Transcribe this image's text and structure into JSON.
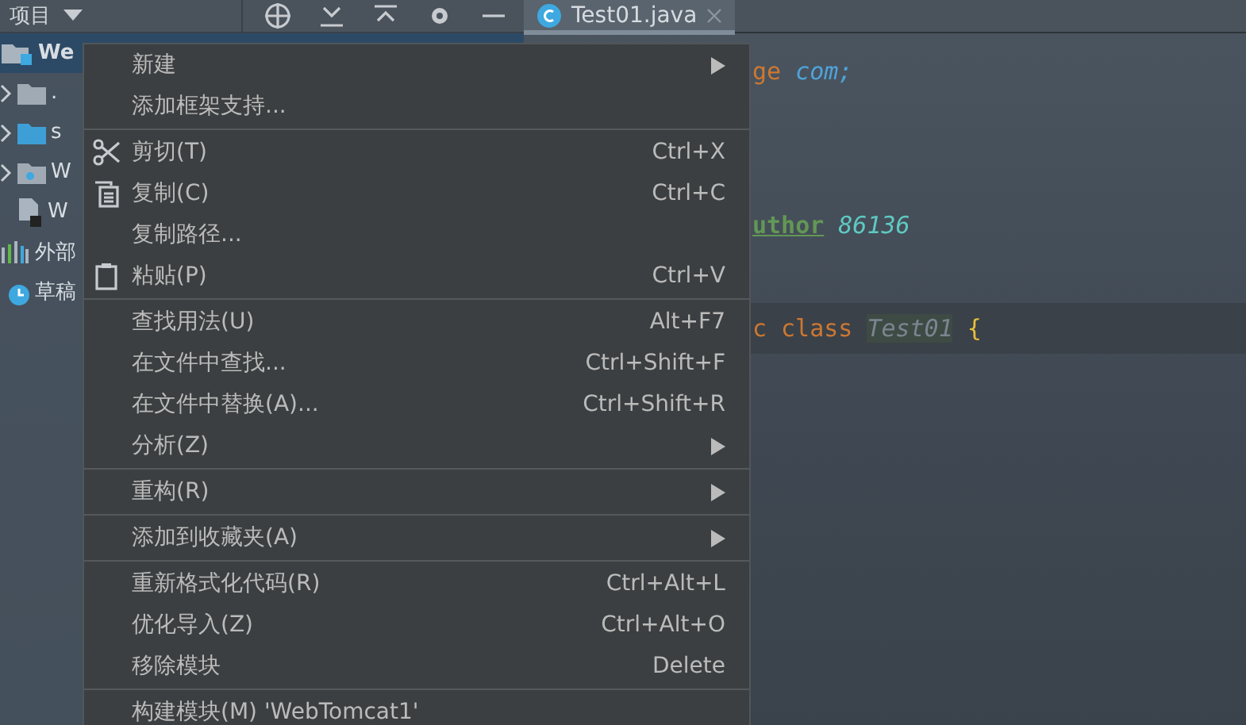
{
  "project_panel": {
    "title": "项目",
    "tree": [
      {
        "label": "We",
        "kind": "module",
        "selected": true,
        "children": [
          {
            "label": ".",
            "kind": "folder",
            "expanded": false
          },
          {
            "label": "s",
            "kind": "source",
            "expanded": false
          },
          {
            "label": "W",
            "kind": "web",
            "expanded": false
          },
          {
            "label": "W",
            "kind": "file"
          }
        ]
      },
      {
        "label": "外部",
        "kind": "library"
      },
      {
        "label": "草稿",
        "kind": "scratch"
      }
    ]
  },
  "editor": {
    "tabs": [
      {
        "label": "Test01.java",
        "selected": true
      }
    ],
    "lines": [
      {
        "kind": "code",
        "current": false,
        "tokens": [
          {
            "text": "ge",
            "kind": "keyword"
          },
          {
            "text": "com;",
            "kind": "package"
          }
        ]
      },
      {
        "kind": "blank"
      },
      {
        "kind": "blank"
      },
      {
        "kind": "code",
        "current": false,
        "tokens": [
          {
            "text": "uthor",
            "kind": "doc-tag"
          },
          {
            "text": "86136",
            "kind": "doc-value"
          }
        ]
      },
      {
        "kind": "blank"
      },
      {
        "kind": "code",
        "current": true,
        "tokens": [
          {
            "text": "c",
            "kind": "keyword"
          },
          {
            "text": "class",
            "kind": "keyword"
          },
          {
            "text": "Test01",
            "kind": "class-name"
          },
          {
            "text": "{",
            "kind": "brace"
          }
        ]
      }
    ]
  },
  "context_menu": {
    "groups": [
      {
        "items": [
          {
            "label": "新建",
            "kind": "plain",
            "submenu": true
          },
          {
            "label": "添加框架支持...",
            "kind": "plain",
            "submenu": false
          }
        ]
      },
      {
        "items": [
          {
            "label": "剪切(T)",
            "shortcut": "Ctrl+X",
            "kind": "cut",
            "submenu": false
          },
          {
            "label": "复制(C)",
            "shortcut": "Ctrl+C",
            "kind": "copy",
            "submenu": false
          },
          {
            "label": "复制路径...",
            "kind": "plain",
            "submenu": false
          },
          {
            "label": "粘贴(P)",
            "shortcut": "Ctrl+V",
            "kind": "paste",
            "submenu": false
          }
        ]
      },
      {
        "items": [
          {
            "label": "查找用法(U)",
            "shortcut": "Alt+F7",
            "kind": "plain",
            "submenu": false
          },
          {
            "label": "在文件中查找...",
            "shortcut": "Ctrl+Shift+F",
            "kind": "plain",
            "submenu": false
          },
          {
            "label": "在文件中替换(A)...",
            "shortcut": "Ctrl+Shift+R",
            "kind": "plain",
            "submenu": false
          },
          {
            "label": "分析(Z)",
            "kind": "plain",
            "submenu": true
          }
        ]
      },
      {
        "items": [
          {
            "label": "重构(R)",
            "kind": "plain",
            "submenu": true
          }
        ]
      },
      {
        "items": [
          {
            "label": "添加到收藏夹(A)",
            "kind": "plain",
            "submenu": true
          }
        ]
      },
      {
        "items": [
          {
            "label": "重新格式化代码(R)",
            "shortcut": "Ctrl+Alt+L",
            "kind": "plain",
            "submenu": false
          },
          {
            "label": "优化导入(Z)",
            "shortcut": "Ctrl+Alt+O",
            "kind": "plain",
            "submenu": false
          },
          {
            "label": "移除模块",
            "shortcut": "Delete",
            "kind": "plain",
            "submenu": false
          }
        ]
      },
      {
        "items": [
          {
            "label": "构建模块(M) 'WebTomcat1'",
            "kind": "plain",
            "submenu": false
          }
        ]
      }
    ]
  }
}
